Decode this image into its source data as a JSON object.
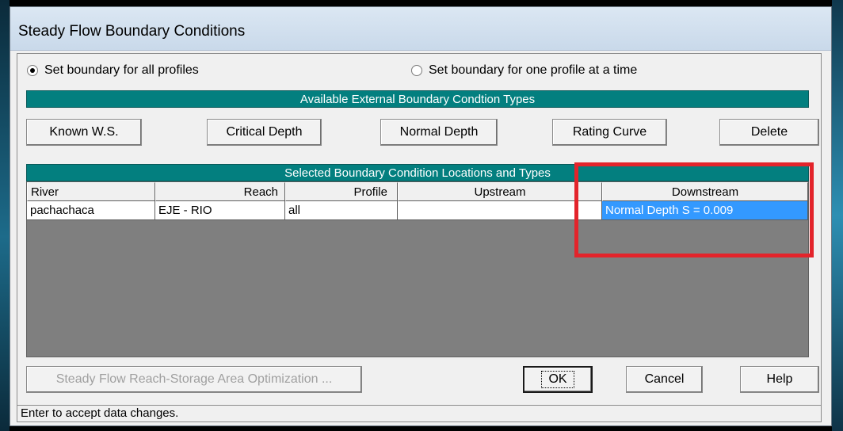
{
  "window": {
    "title": "Steady Flow Boundary Conditions"
  },
  "radios": {
    "all_profiles": {
      "label": "Set boundary for all profiles",
      "checked": true
    },
    "one_profile": {
      "label": "Set boundary for one profile at a time",
      "checked": false
    }
  },
  "available_band": "Available External Boundary Condtion Types",
  "buttons": {
    "known_ws": "Known W.S.",
    "critical_depth": "Critical Depth",
    "normal_depth": "Normal Depth",
    "rating_curve": "Rating Curve",
    "delete": "Delete",
    "optimization": "Steady Flow Reach-Storage Area Optimization ...",
    "ok": "OK",
    "cancel": "Cancel",
    "help": "Help"
  },
  "selected_band": "Selected Boundary Condition Locations and Types",
  "table": {
    "headers": [
      "River",
      "Reach",
      "Profile",
      "Upstream",
      "Downstream"
    ],
    "rows": [
      [
        "pachachaca",
        "EJE - RIO",
        "all",
        "",
        "Normal Depth S = 0.009"
      ]
    ]
  },
  "status_bar": "Enter to accept data changes.",
  "colors": {
    "band": "#037f7f",
    "selection": "#3399ff",
    "highlight": "#e3242b"
  }
}
